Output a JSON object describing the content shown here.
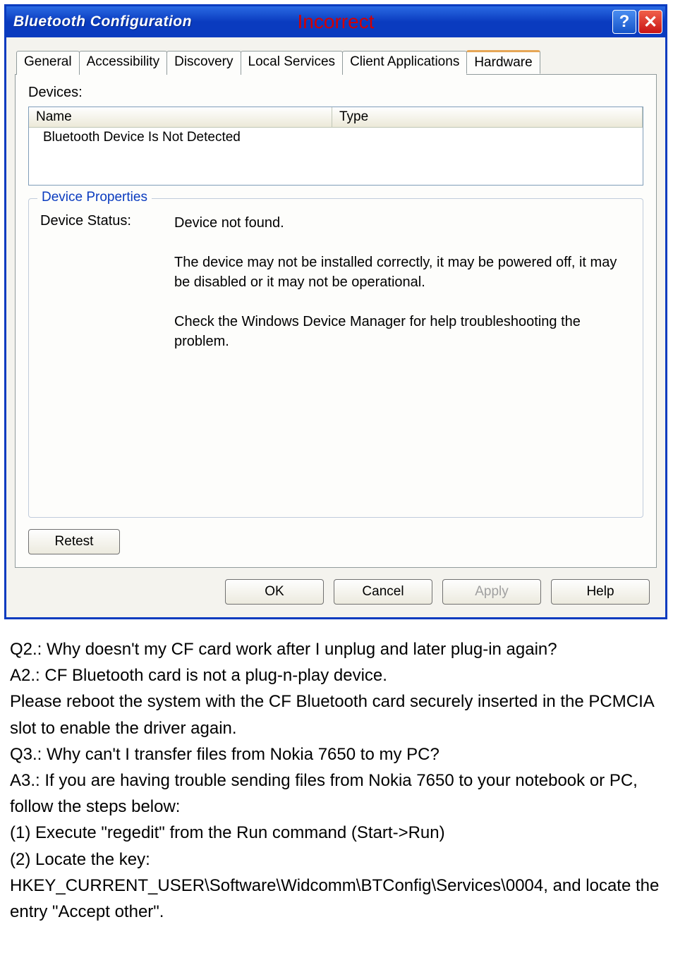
{
  "window": {
    "title": "Bluetooth Configuration",
    "overlay": "Incorrect"
  },
  "tabs": [
    {
      "label": "General"
    },
    {
      "label": "Accessibility"
    },
    {
      "label": "Discovery"
    },
    {
      "label": "Local Services"
    },
    {
      "label": "Client Applications"
    },
    {
      "label": "Hardware"
    }
  ],
  "hardware": {
    "devices_label": "Devices:",
    "columns": {
      "name": "Name",
      "type": "Type"
    },
    "row": "Bluetooth Device Is Not Detected",
    "group_legend": "Device Properties",
    "status_label": "Device Status:",
    "status_value": "Device not found.\n\nThe device may not be installed correctly, it may be powered off, it may be disabled or it may not be operational.\n\nCheck the Windows Device Manager for help troubleshooting the problem."
  },
  "buttons": {
    "retest": "Retest",
    "ok": "OK",
    "cancel": "Cancel",
    "apply": "Apply",
    "help": "Help"
  },
  "document": {
    "lines": [
      "Q2.: Why doesn't my CF card work after I unplug and later plug-in again?",
      "A2.: CF Bluetooth card is not a plug-n-play device.",
      "Please reboot the system with the CF Bluetooth card securely inserted in the PCMCIA slot to enable the driver again.",
      "Q3.: Why can't I transfer files from Nokia 7650 to my PC?",
      "A3.: If you are having trouble sending files from Nokia 7650 to your notebook or PC, follow the steps below:",
      "(1) Execute \"regedit\" from the Run command (Start->Run)",
      "(2) Locate the key: HKEY_CURRENT_USER\\Software\\Widcomm\\BTConfig\\Services\\0004, and locate the entry \"Accept other\"."
    ]
  }
}
